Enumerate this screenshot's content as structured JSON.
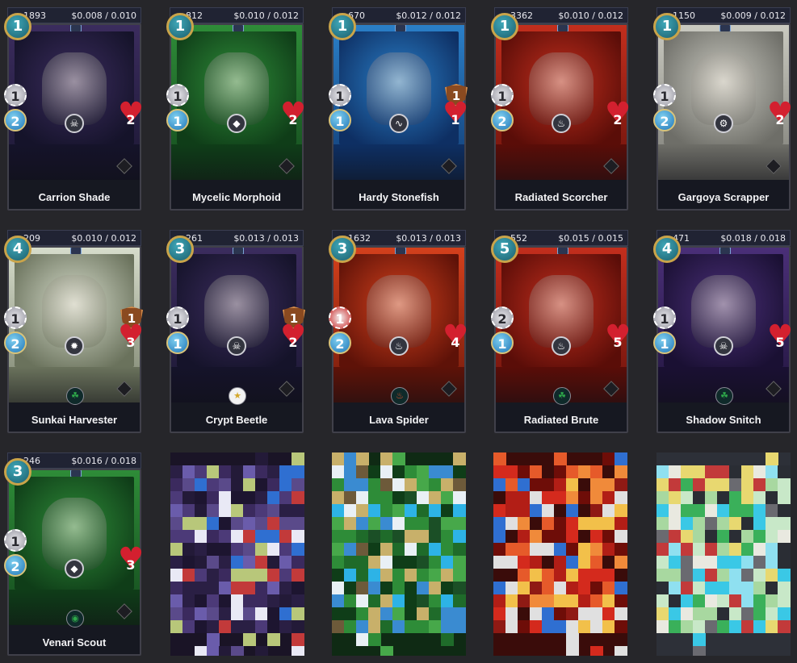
{
  "cards": [
    {
      "count": "1893",
      "price": "$0.008 / 0.010",
      "name": "Carrion Shade",
      "mana": "1",
      "attack": "1",
      "speed": "2",
      "health": "2",
      "armor": "",
      "ability_icon": "skull-icon",
      "element_icon": "",
      "theme": "#3b2c5e",
      "theme_dark": "#15132a",
      "attack_style": "silver"
    },
    {
      "count": "812",
      "price": "$0.010 / 0.012",
      "name": "Mycelic Morphoid",
      "mana": "1",
      "attack": "1",
      "speed": "1",
      "health": "2",
      "armor": "",
      "ability_icon": "shield-icon",
      "element_icon": "",
      "theme": "#2e8c38",
      "theme_dark": "#0f3d18",
      "attack_style": "silver"
    },
    {
      "count": "670",
      "price": "$0.012 / 0.012",
      "name": "Hardy Stonefish",
      "mana": "1",
      "attack": "1",
      "speed": "1",
      "health": "1",
      "armor": "1",
      "ability_icon": "wave-icon",
      "element_icon": "",
      "theme": "#2a7fc8",
      "theme_dark": "#0e2f63",
      "attack_style": "silver"
    },
    {
      "count": "3362",
      "price": "$0.010 / 0.012",
      "name": "Radiated Scorcher",
      "mana": "1",
      "attack": "1",
      "speed": "2",
      "health": "2",
      "armor": "",
      "ability_icon": "flame-icon",
      "element_icon": "",
      "theme": "#c22e1d",
      "theme_dark": "#5a0d08",
      "attack_style": "silver"
    },
    {
      "count": "1150",
      "price": "$0.009 / 0.012",
      "name": "Gargoya Scrapper",
      "mana": "1",
      "attack": "1",
      "speed": "2",
      "health": "2",
      "armor": "",
      "ability_icon": "gear-icon",
      "element_icon": "",
      "theme": "#c9c9c0",
      "theme_dark": "#6e6e68",
      "attack_style": "silver"
    },
    {
      "count": "209",
      "price": "$0.010 / 0.012",
      "name": "Sunkai Harvester",
      "mana": "4",
      "attack": "1",
      "speed": "2",
      "health": "3",
      "armor": "1",
      "ability_icon": "sun-icon",
      "element_icon": "leaf-icon",
      "theme": "#d6dccb",
      "theme_dark": "#6a725c",
      "attack_style": "silver"
    },
    {
      "count": "261",
      "price": "$0.013 / 0.013",
      "name": "Crypt Beetle",
      "mana": "3",
      "attack": "1",
      "speed": "1",
      "health": "2",
      "armor": "1",
      "ability_icon": "skull-icon",
      "element_icon": "star-icon",
      "theme": "#3b2c5e",
      "theme_dark": "#15132a",
      "attack_style": "silver"
    },
    {
      "count": "1632",
      "price": "$0.013 / 0.013",
      "name": "Lava Spider",
      "mana": "3",
      "attack": "1",
      "speed": "2",
      "health": "4",
      "armor": "",
      "ability_icon": "flame-icon",
      "element_icon": "flame-icon",
      "theme": "#d3401c",
      "theme_dark": "#5e1208",
      "attack_style": "red"
    },
    {
      "count": "552",
      "price": "$0.015 / 0.015",
      "name": "Radiated Brute",
      "mana": "5",
      "attack": "2",
      "speed": "1",
      "health": "5",
      "armor": "",
      "ability_icon": "flame-icon",
      "element_icon": "leaf-icon",
      "theme": "#c22e1d",
      "theme_dark": "#5a0d08",
      "attack_style": "silver"
    },
    {
      "count": "471",
      "price": "$0.018 / 0.018",
      "name": "Shadow Snitch",
      "mana": "4",
      "attack": "1",
      "speed": "1",
      "health": "5",
      "armor": "",
      "ability_icon": "skull-icon",
      "element_icon": "leaf-icon",
      "theme": "#4a2f78",
      "theme_dark": "#1a1033",
      "attack_style": "silver"
    },
    {
      "count": "246",
      "price": "$0.016 / 0.018",
      "name": "Venari Scout",
      "mana": "3",
      "attack": "1",
      "speed": "2",
      "health": "3",
      "armor": "",
      "ability_icon": "shield-icon",
      "element_icon": "eye-icon",
      "theme": "#2e8c38",
      "theme_dark": "#0f3d18",
      "attack_style": "silver"
    }
  ],
  "icons": {
    "chevron": "chevron-down-icon"
  }
}
